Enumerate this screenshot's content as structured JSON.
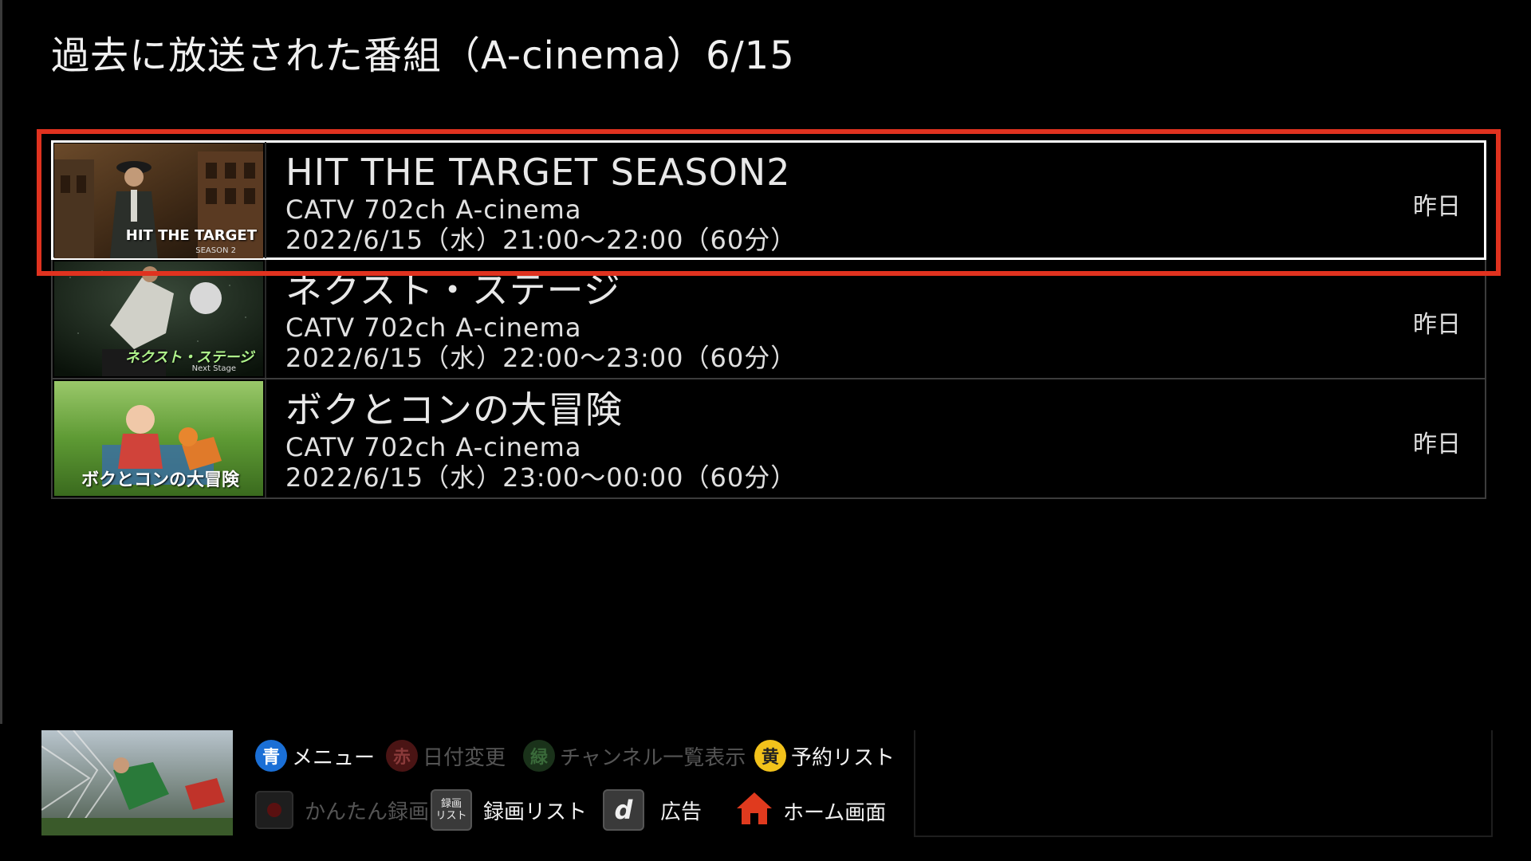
{
  "header": {
    "title": "過去に放送された番組（A-cinema）6/15"
  },
  "programs": [
    {
      "title": "HIT THE TARGET SEASON2",
      "channel": "CATV  702ch  A-cinema",
      "datetime": "2022/6/15（水）21:00〜22:00（60分）",
      "day": "昨日",
      "thumb_caption": "HIT THE TARGET",
      "thumb_subcaption": "SEASON 2",
      "selected": true
    },
    {
      "title": "ネクスト・ステージ",
      "channel": "CATV  702ch  A-cinema",
      "datetime": "2022/6/15（水）22:00〜23:00（60分）",
      "day": "昨日",
      "thumb_caption": "ネクスト・ステージ",
      "thumb_subcaption": "Next Stage"
    },
    {
      "title": "ボクとコンの大冒険",
      "channel": "CATV  702ch  A-cinema",
      "datetime": "2022/6/15（水）23:00〜00:00（60分）",
      "day": "昨日",
      "thumb_caption": "ボクとコンの大冒険"
    }
  ],
  "footer": {
    "blue": {
      "key": "青",
      "label": "メニュー",
      "color": "#1a6fd6"
    },
    "red": {
      "key": "赤",
      "label": "日付変更",
      "color": "#5a1a1a"
    },
    "green": {
      "key": "緑",
      "label": "チャンネル一覧表示",
      "color": "#1c3a1c"
    },
    "yellow": {
      "key": "黄",
      "label": "予約リスト",
      "color": "#f2c21b"
    },
    "easy_record": {
      "label": "かんたん録画",
      "icon": "record-icon"
    },
    "record_list": {
      "key_line1": "録画",
      "key_line2": "リスト",
      "label": "録画リスト"
    },
    "d_button": {
      "key": "d",
      "label": "広告"
    },
    "home": {
      "label": "ホーム画面",
      "icon": "home-icon",
      "color": "#e03a1e"
    }
  }
}
